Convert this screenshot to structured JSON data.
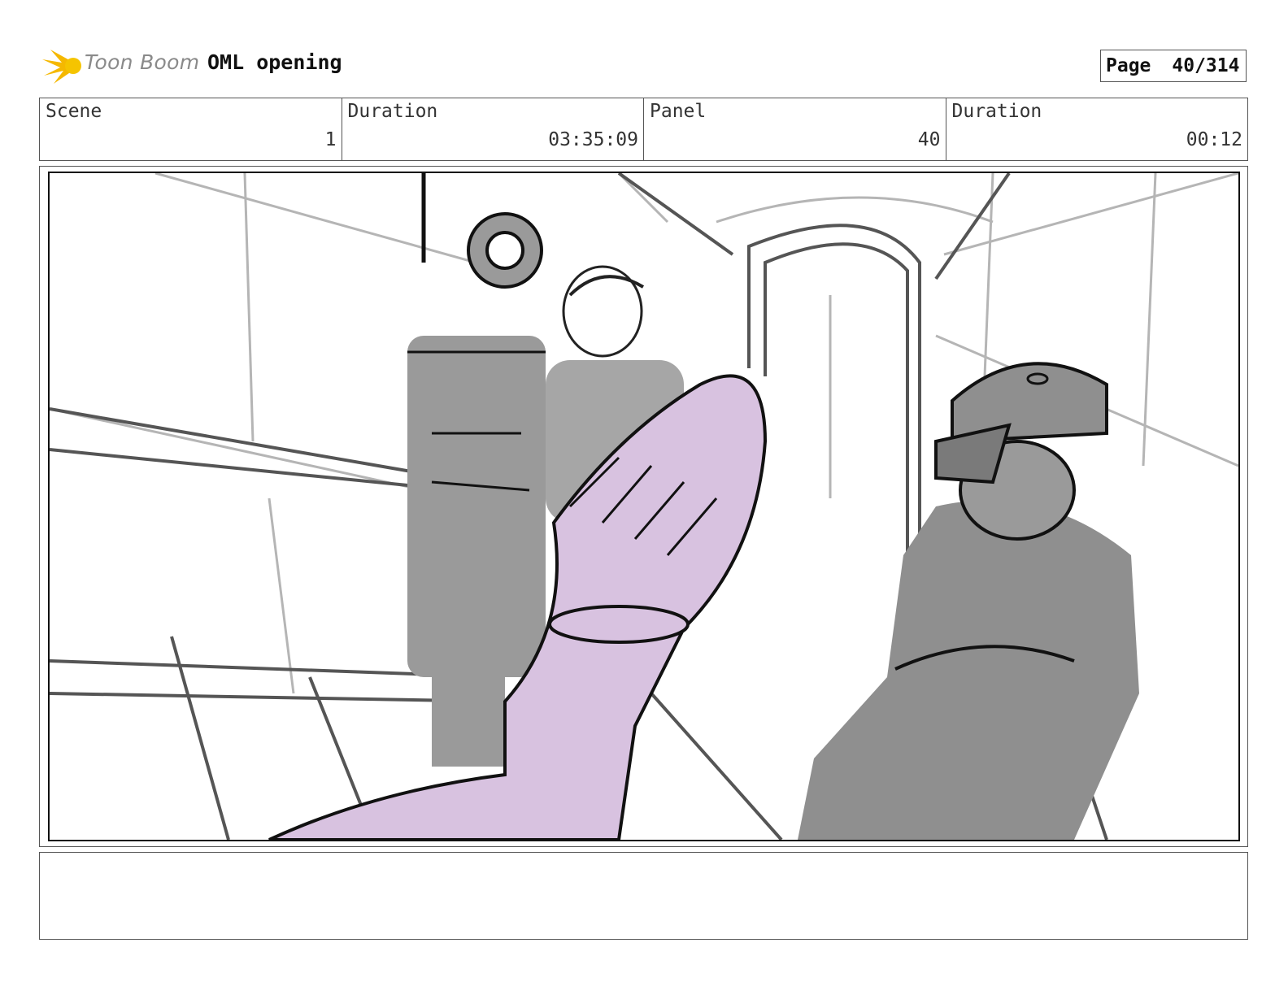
{
  "header": {
    "brand": "Toon Boom",
    "project_title": "OML opening",
    "page_label": "Page",
    "page_value": "40/314"
  },
  "info": {
    "scene_label": "Scene",
    "scene_value": "1",
    "scene_duration_label": "Duration",
    "scene_duration_value": "03:35:09",
    "panel_label": "Panel",
    "panel_value": "40",
    "panel_duration_label": "Duration",
    "panel_duration_value": "00:12"
  },
  "colors": {
    "brand_yellow": "#f5b800",
    "highlight_purple": "#d8c2e0",
    "figure_gray": "#9a9a9a"
  },
  "notes": ""
}
